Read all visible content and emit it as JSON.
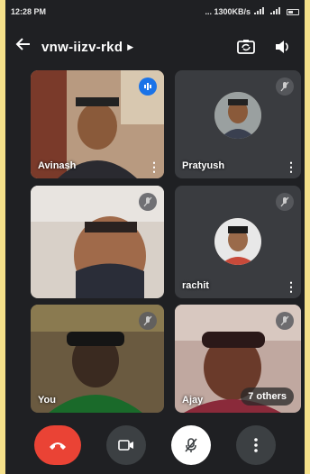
{
  "status_bar": {
    "time": "12:28 PM",
    "network_info": "... 1300KB/s",
    "battery_icon": "battery-icon"
  },
  "header": {
    "back_icon": "arrow-left-icon",
    "meeting_code": "vnw-iizv-rkd",
    "switch_camera_icon": "switch-camera-icon",
    "speaker_icon": "speaker-icon"
  },
  "participants": [
    {
      "name": "Avinash",
      "mic": "speaking"
    },
    {
      "name": "Pratyush",
      "mic": "muted"
    },
    {
      "name": "",
      "mic": "muted"
    },
    {
      "name": "rachit",
      "mic": "muted"
    },
    {
      "name": "You",
      "mic": "muted"
    },
    {
      "name": "Ajay",
      "mic": "muted",
      "others": "7 others"
    }
  ],
  "controls": {
    "end_call_icon": "phone-hangup-icon",
    "camera_icon": "video-camera-icon",
    "mic_icon": "mic-off-icon",
    "more_icon": "more-vertical-icon"
  },
  "colors": {
    "frame": "#f5e08a",
    "background": "#1f2023",
    "end_call": "#ea4335",
    "speaking_badge": "#1a73e8"
  }
}
